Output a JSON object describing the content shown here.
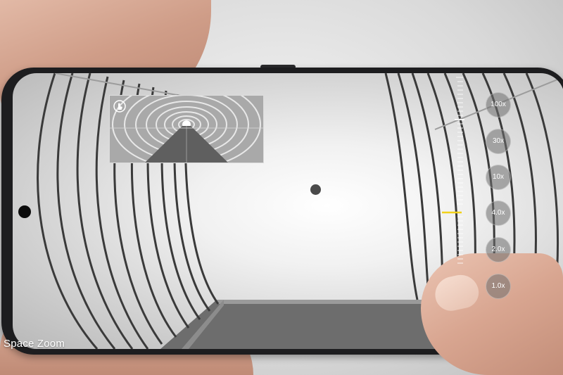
{
  "camera": {
    "zoom_levels": [
      "100x",
      "30x",
      "10x",
      "4.0x",
      "2.0x",
      "1.0x"
    ],
    "selected_zoom": "4.0x",
    "icons": {
      "preview_corner": "hand-touch-icon",
      "focus": "focus-dot-icon"
    },
    "colors": {
      "indicator": "#f2d21a",
      "button_bg": "#6e6e6e",
      "label": "#ffffff"
    }
  },
  "caption": {
    "text": "Space Zoom"
  }
}
